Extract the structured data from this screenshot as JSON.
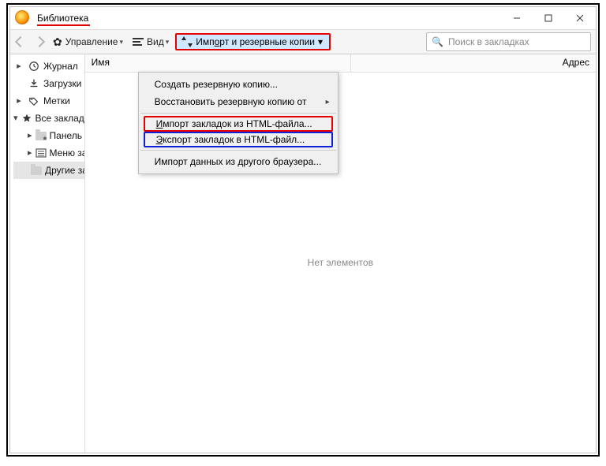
{
  "window": {
    "title": "Библиотека"
  },
  "toolbar": {
    "manage_label": "Управление",
    "view_label": "Вид",
    "import_label": "Импорт и резервные копии"
  },
  "search": {
    "placeholder": "Поиск в закладках"
  },
  "columns": {
    "name": "Имя",
    "address": "Адрес"
  },
  "sidebar": {
    "history": "Журнал",
    "downloads": "Загрузки",
    "tags": "Метки",
    "all_bookmarks": "Все закладки",
    "toolbar_bookmarks": "Панель закладок",
    "menu_bookmarks": "Меню закладок",
    "other_bookmarks": "Другие закладки"
  },
  "menu": {
    "create_backup": "Создать резервную копию...",
    "restore_from": "Восстановить резервную копию от",
    "import_html": "Импорт закладок из HTML-файла...",
    "export_html": "Экспорт закладок в HTML-файл...",
    "import_browser": "Импорт данных из другого браузера..."
  },
  "content": {
    "empty": "Нет элементов"
  }
}
